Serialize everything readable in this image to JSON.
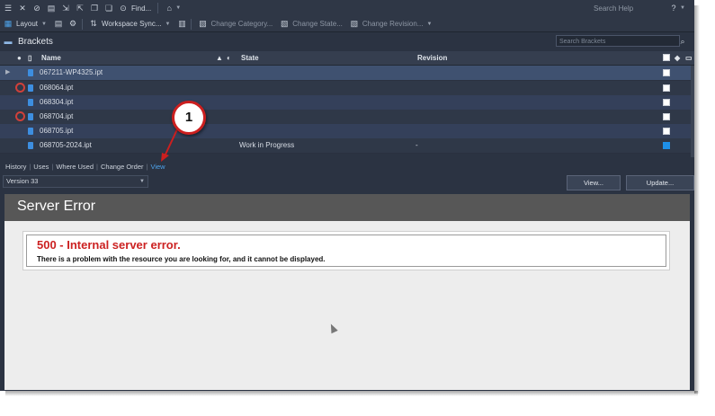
{
  "toolbar_top": {
    "find_label": "Find...",
    "help_placeholder": "Search Help",
    "help_icon": "?"
  },
  "toolbar_second": {
    "layout_label": "Layout",
    "workspace_sync_label": "Workspace Sync...",
    "change_category_label": "Change Category...",
    "change_state_label": "Change State...",
    "change_revision_label": "Change Revision..."
  },
  "title_bar": {
    "title": "Brackets",
    "search_placeholder": "Search Brackets"
  },
  "grid": {
    "columns": {
      "name": "Name",
      "state": "State",
      "revision": "Revision"
    },
    "rows": [
      {
        "name": "067211-WP4325.ipt",
        "state": "",
        "revision": "",
        "warning": false,
        "checked": false,
        "selected": true
      },
      {
        "name": "068064.ipt",
        "state": "",
        "revision": "",
        "warning": true,
        "checked": false,
        "selected": false
      },
      {
        "name": "068304.ipt",
        "state": "",
        "revision": "",
        "warning": false,
        "checked": false,
        "selected": false
      },
      {
        "name": "068704.ipt",
        "state": "",
        "revision": "",
        "warning": true,
        "checked": false,
        "selected": false
      },
      {
        "name": "068705.ipt",
        "state": "",
        "revision": "",
        "warning": false,
        "checked": false,
        "selected": false
      },
      {
        "name": "068705-2024.ipt",
        "state": "Work in Progress",
        "revision": "-",
        "warning": false,
        "checked": true,
        "selected": false
      }
    ]
  },
  "tabs": {
    "history": "History",
    "uses": "Uses",
    "where_used": "Where Used",
    "change_order": "Change Order",
    "view": "View"
  },
  "version_select": {
    "value": "Version 33"
  },
  "buttons": {
    "view": "View...",
    "update": "Update..."
  },
  "error_panel": {
    "header": "Server Error",
    "title": "500 - Internal server error.",
    "message": "There is a problem with the resource you are looking for, and it cannot be displayed."
  },
  "callout": {
    "number": "1"
  },
  "colors": {
    "background": "#2b3342",
    "accent": "#4ea3ea",
    "error_red": "#cc2222",
    "callout_border": "#cc1f1f"
  }
}
